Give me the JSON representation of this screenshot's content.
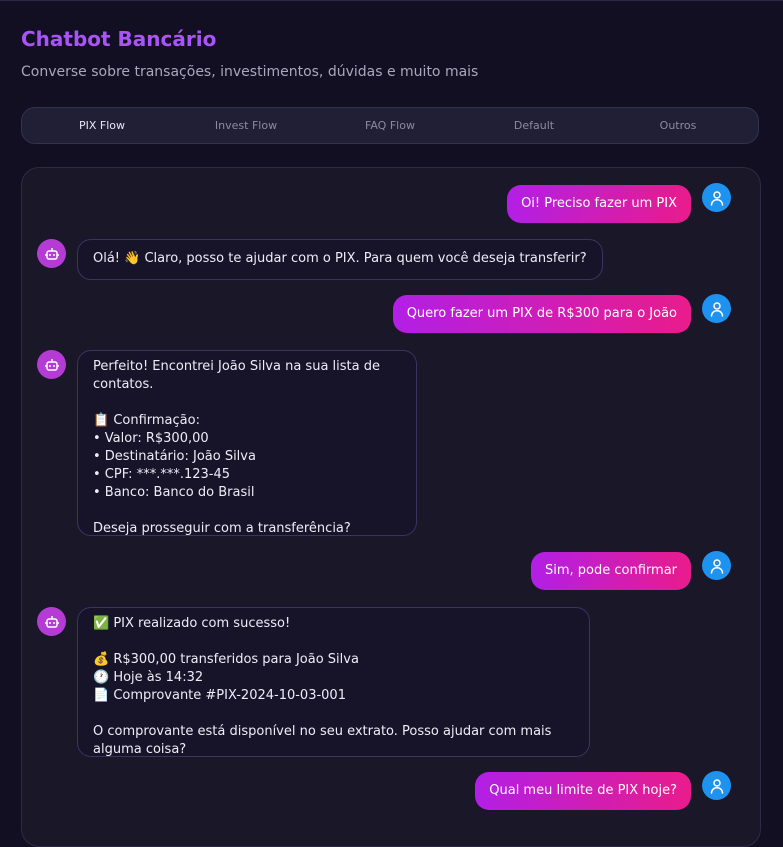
{
  "header": {
    "title": "Chatbot Bancário",
    "subtitle": "Converse sobre transações, investimentos, dúvidas e muito mais"
  },
  "tabs": [
    {
      "label": "PIX Flow",
      "active": true
    },
    {
      "label": "Invest Flow",
      "active": false
    },
    {
      "label": "FAQ Flow",
      "active": false
    },
    {
      "label": "Default",
      "active": false
    },
    {
      "label": "Outros",
      "active": false
    }
  ],
  "icons": {
    "user_avatar": "user-icon",
    "bot_avatar": "robot-icon"
  },
  "colors": {
    "accent": "#a855f7",
    "user_bubble_from": "#b21fe6",
    "user_bubble_to": "#e91c8b",
    "user_avatar": "#1d93ef",
    "bot_avatar": "#b43cd4"
  },
  "messages": [
    {
      "role": "user",
      "text": "Oi! Preciso fazer um PIX"
    },
    {
      "role": "bot",
      "text": "Olá! 👋 Claro, posso te ajudar com o PIX. Para quem você deseja transferir?"
    },
    {
      "role": "user",
      "text": "Quero fazer um PIX de R$300 para o João"
    },
    {
      "role": "bot",
      "text": "Perfeito! Encontrei João Silva na sua lista de contatos.\n\n📋 Confirmação:\n• Valor: R$300,00\n• Destinatário: João Silva\n• CPF: ***.***.123-45\n• Banco: Banco do Brasil\n\nDeseja prosseguir com a transferência?"
    },
    {
      "role": "user",
      "text": "Sim, pode confirmar"
    },
    {
      "role": "bot",
      "text": "✅ PIX realizado com sucesso!\n\n💰 R$300,00 transferidos para João Silva\n🕐 Hoje às 14:32\n📄 Comprovante #PIX-2024-10-03-001\n\nO comprovante está disponível no seu extrato. Posso ajudar com mais alguma coisa?"
    },
    {
      "role": "user",
      "text": "Qual meu limite de PIX hoje?"
    }
  ]
}
